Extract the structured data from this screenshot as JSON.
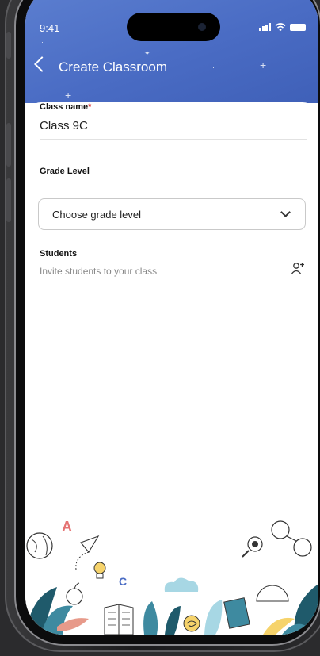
{
  "status_bar": {
    "time": "9:41"
  },
  "header": {
    "title": "Create Classroom"
  },
  "form": {
    "class_name": {
      "label": "Class name",
      "required_mark": "*",
      "value": "Class 9C"
    },
    "grade_level": {
      "label": "Grade Level",
      "selected": "Choose grade level"
    },
    "students": {
      "label": "Students",
      "placeholder": "Invite students to your class"
    }
  },
  "decoration": {
    "letter_a": "A",
    "letter_c": "C"
  },
  "colors": {
    "header": "#4a6cc4",
    "required": "#d62b2b"
  },
  "icons": [
    "back-chevron-icon",
    "chevron-down-icon",
    "add-user-icon",
    "signal-icon",
    "wifi-icon",
    "battery-icon"
  ]
}
